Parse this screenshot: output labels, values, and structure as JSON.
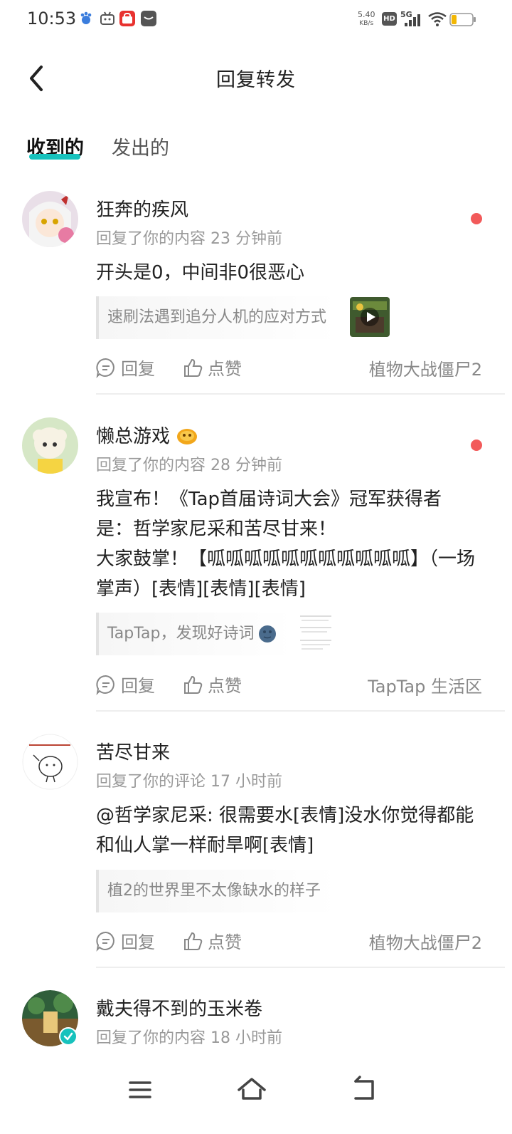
{
  "status_bar": {
    "time": "10:53",
    "speed_value": "5.40",
    "speed_unit": "KB/s",
    "hd_label": "HD",
    "network_label": "5G",
    "battery_level": 0.25
  },
  "header": {
    "title": "回复转发",
    "back_icon": "chevron-left-icon"
  },
  "tabs": [
    {
      "label": "收到的",
      "active": true
    },
    {
      "label": "发出的",
      "active": false
    }
  ],
  "accent_color": "#17c2bd",
  "unread_color": "#f25a5a",
  "items": [
    {
      "username": "狂奔的疾风",
      "meta": "回复了你的内容 23 分钟前",
      "unread": true,
      "content": "开头是0，中间非0很恶心",
      "quote": "速刷法遇到追分人机的应对方式",
      "quote_thumb": "video-thumbnail",
      "reply_label": "回复",
      "like_label": "点赞",
      "category": "植物大战僵尸2"
    },
    {
      "username": "懒总游戏",
      "meta": "回复了你的内容 28 分钟前",
      "unread": true,
      "content": "我宣布！《Tap首届诗词大会》冠军获得者是：哲学家尼采和苦尽甘来！\n大家鼓掌！【呱呱呱呱呱呱呱呱呱呱呱】（一场掌声）[表情][表情][表情]",
      "quote": "TapTap，发现好诗词",
      "quote_thumb": "screenshot-thumbnail",
      "reply_label": "回复",
      "like_label": "点赞",
      "category": "TapTap 生活区"
    },
    {
      "username": "苦尽甘来",
      "meta": "回复了你的评论 17 小时前",
      "unread": false,
      "content": "@哲学家尼采: 很需要水[表情]没水你觉得都能和仙人掌一样耐旱啊[表情]",
      "quote": "植2的世界里不太像缺水的样子",
      "reply_label": "回复",
      "like_label": "点赞",
      "category": "植物大战僵尸2"
    },
    {
      "username": "戴夫得不到的玉米卷",
      "meta": "回复了你的内容 18 小时前",
      "unread": false
    }
  ],
  "nav_bar": {
    "menu_icon": "menu-icon",
    "home_icon": "home-icon",
    "back_icon": "back-icon"
  }
}
